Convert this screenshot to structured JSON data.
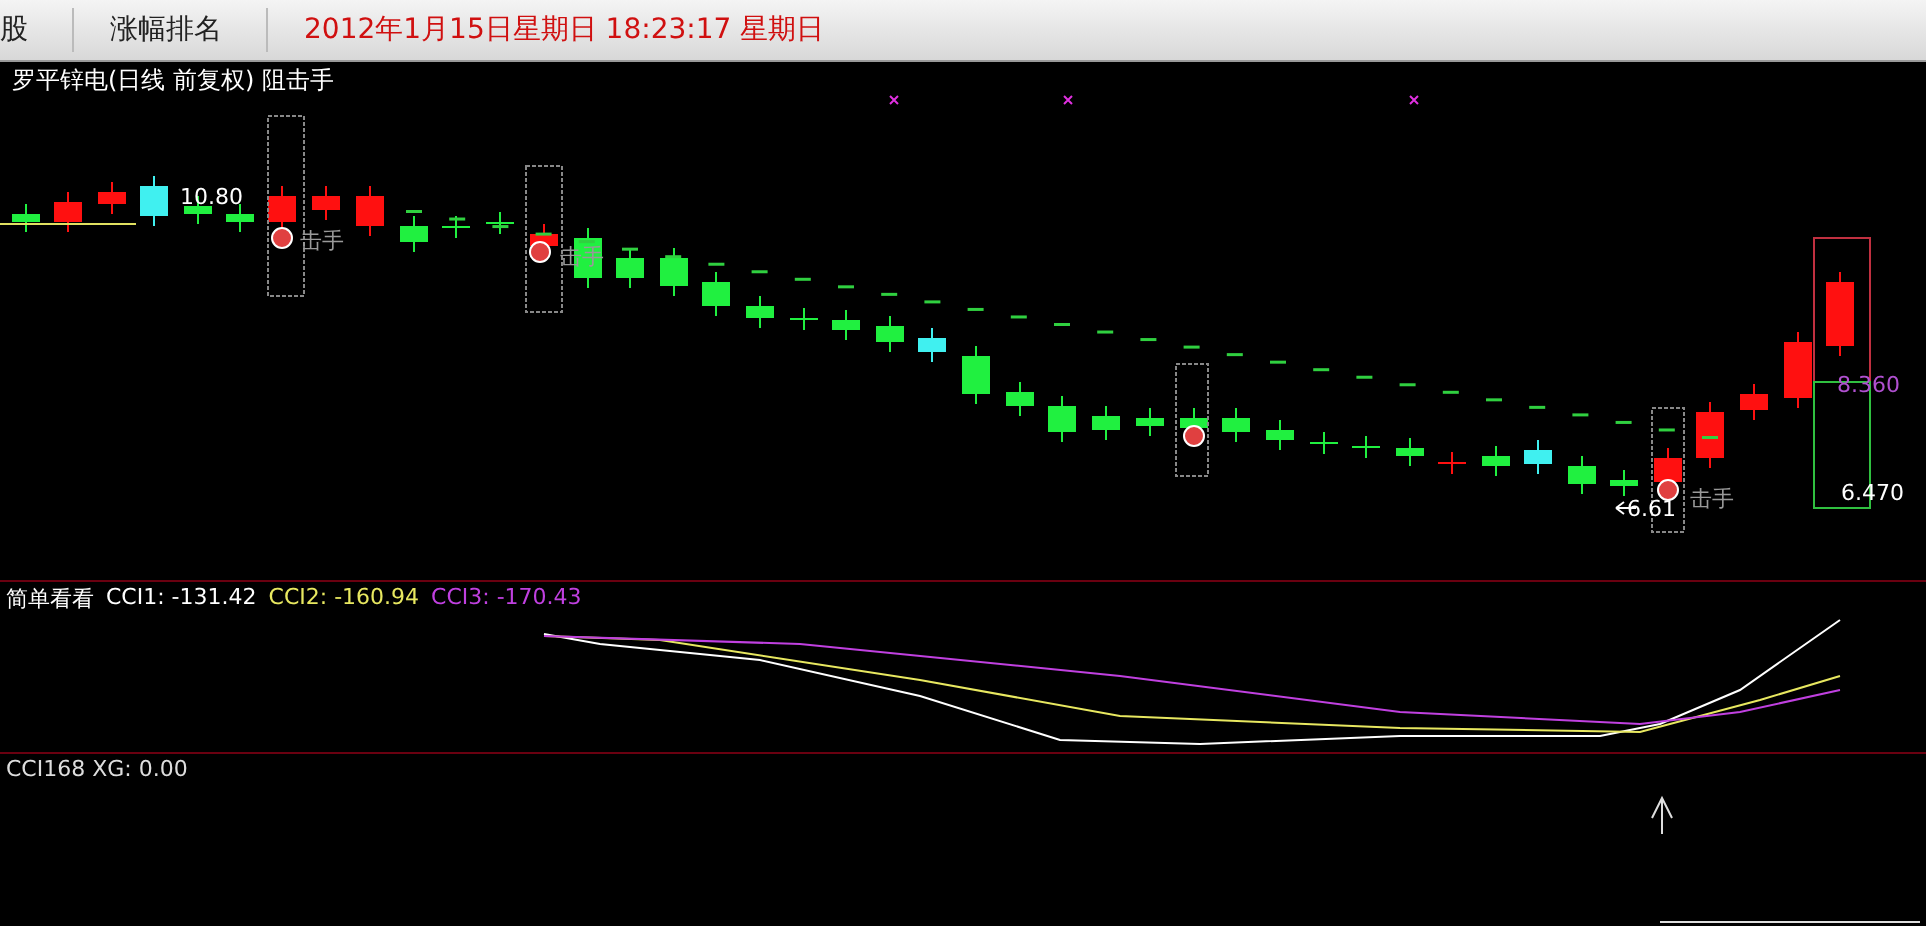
{
  "toolbar": {
    "tabs": [
      {
        "label": "股"
      },
      {
        "label": "涨幅排名"
      }
    ],
    "datetime": "2012年1月15日星期日  18:23:17 星期日"
  },
  "main_panel": {
    "title": "罗平锌电(日线 前复权) 阻击手",
    "annotations": [
      {
        "kind": "price",
        "text": "10.80"
      },
      {
        "kind": "signal",
        "text": "击手"
      },
      {
        "kind": "signal",
        "text": "击手"
      },
      {
        "kind": "low",
        "text": "6.61"
      },
      {
        "kind": "signal",
        "text": "击手"
      },
      {
        "kind": "high",
        "text": "8.360"
      },
      {
        "kind": "price",
        "text": "6.470"
      }
    ]
  },
  "cci_panel": {
    "name": "简单看看",
    "series": [
      {
        "label": "CCI1: -131.42",
        "color": "#ffffff"
      },
      {
        "label": "CCI2: -160.94",
        "color": "#e8e860"
      },
      {
        "label": "CCI3: -170.43",
        "color": "#c040e0"
      }
    ]
  },
  "signal_panel": {
    "label": "CCI168 XG: 0.00"
  }
}
